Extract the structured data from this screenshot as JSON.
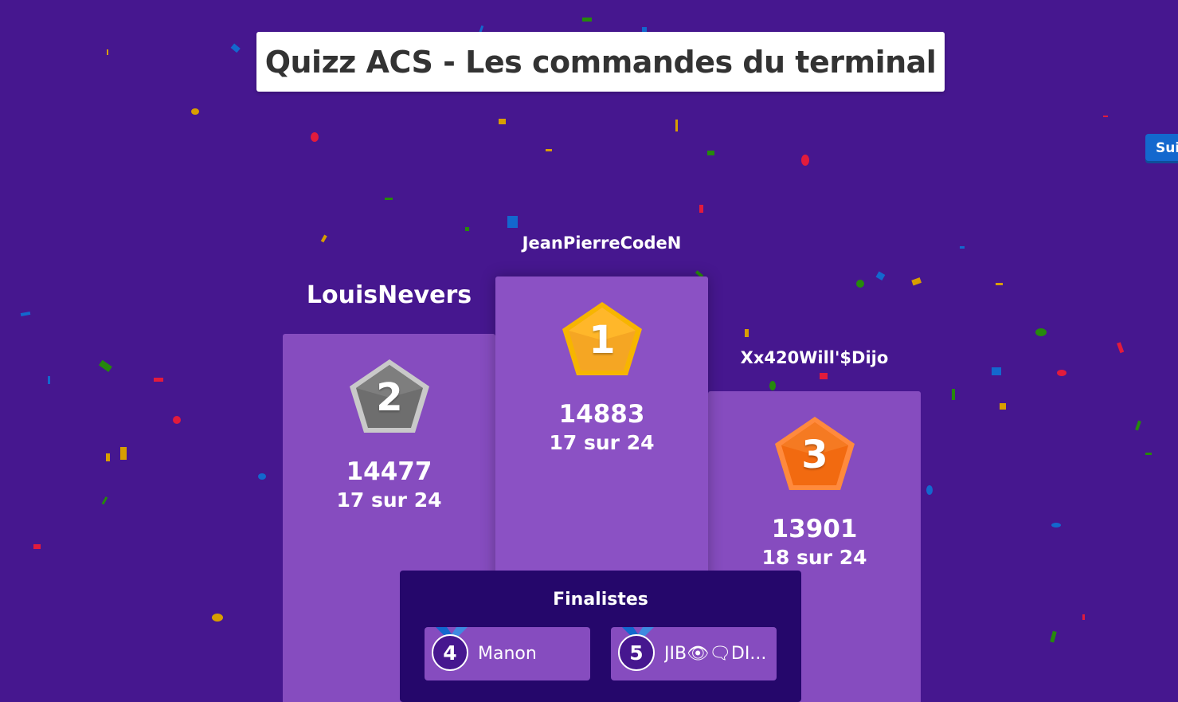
{
  "quiz": {
    "title": "Quizz ACS - Les commandes du terminal"
  },
  "controls": {
    "next_label": "Suivant"
  },
  "podium": [
    {
      "rank": "1",
      "name": "JeanPierreCodeN",
      "score": "14883",
      "correct": "17 sur 24",
      "medal_color": "#f5a623"
    },
    {
      "rank": "2",
      "name": "LouisNevers",
      "score": "14477",
      "correct": "17 sur 24",
      "medal_color": "#7a7a7a"
    },
    {
      "rank": "3",
      "name": "Xx420Will'$Dijo",
      "score": "13901",
      "correct": "18 sur 24",
      "medal_color": "#f26a10"
    }
  ],
  "finalists": {
    "title": "Finalistes",
    "items": [
      {
        "rank": "4",
        "name": "Manon"
      },
      {
        "rank": "5",
        "name": "JIB👁🗨DI..."
      }
    ]
  },
  "colors": {
    "background": "#46178f",
    "podium": "#864cbf",
    "finalists_panel": "#25076b",
    "next_button": "#1368ce"
  }
}
